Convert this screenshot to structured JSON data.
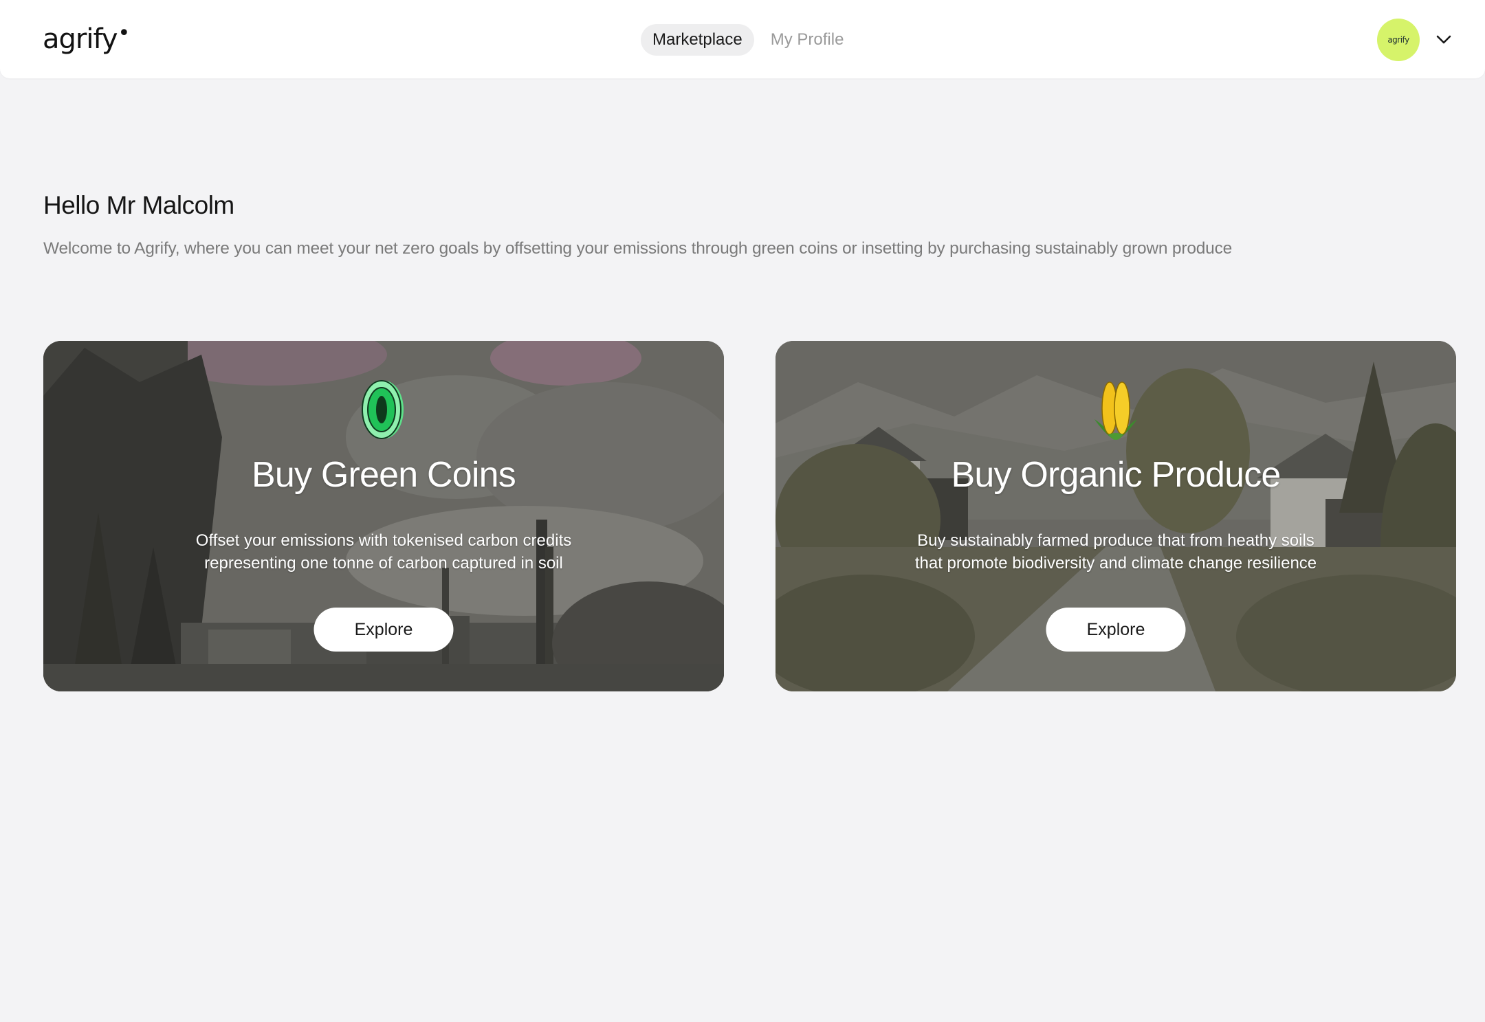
{
  "header": {
    "logo_text": "agrify",
    "nav": {
      "marketplace_label": "Marketplace",
      "profile_label": "My Profile"
    },
    "avatar_text": "agrify",
    "accent_color": "#d6f36a"
  },
  "main": {
    "greeting": "Hello Mr Malcolm",
    "subtitle": "Welcome to Agrify, where you can meet your net zero goals by offsetting your emissions through green coins or insetting by purchasing sustainably grown produce"
  },
  "cards": [
    {
      "icon": "green-coin-icon",
      "title": "Buy Green Coins",
      "description": "Offset your emissions with tokenised carbon credits representing one tonne of carbon captured in soil",
      "button_label": "Explore"
    },
    {
      "icon": "corn-icon",
      "title": "Buy Organic Produce",
      "description": "Buy sustainably farmed produce that from heathy soils that promote biodiversity and climate change resilience",
      "button_label": "Explore"
    }
  ]
}
